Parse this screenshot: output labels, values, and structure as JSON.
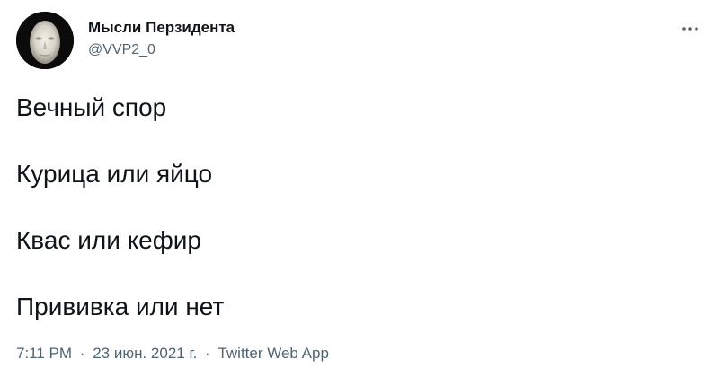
{
  "author": {
    "display_name": "Мысли Перзидента",
    "handle": "@VVP2_0",
    "avatar_icon": "portrait-avatar-icon"
  },
  "menu": {
    "icon": "more-options-icon"
  },
  "tweet": {
    "lines": [
      "Вечный спор",
      "Курица или яйцо",
      "Квас или кефир",
      "Прививка или нет"
    ]
  },
  "meta": {
    "time": "7:11 PM",
    "separator": "·",
    "date": "23 июн. 2021 г.",
    "source": "Twitter Web App"
  },
  "colors": {
    "text": "#0f1419",
    "secondary": "#536471",
    "background": "#ffffff"
  }
}
